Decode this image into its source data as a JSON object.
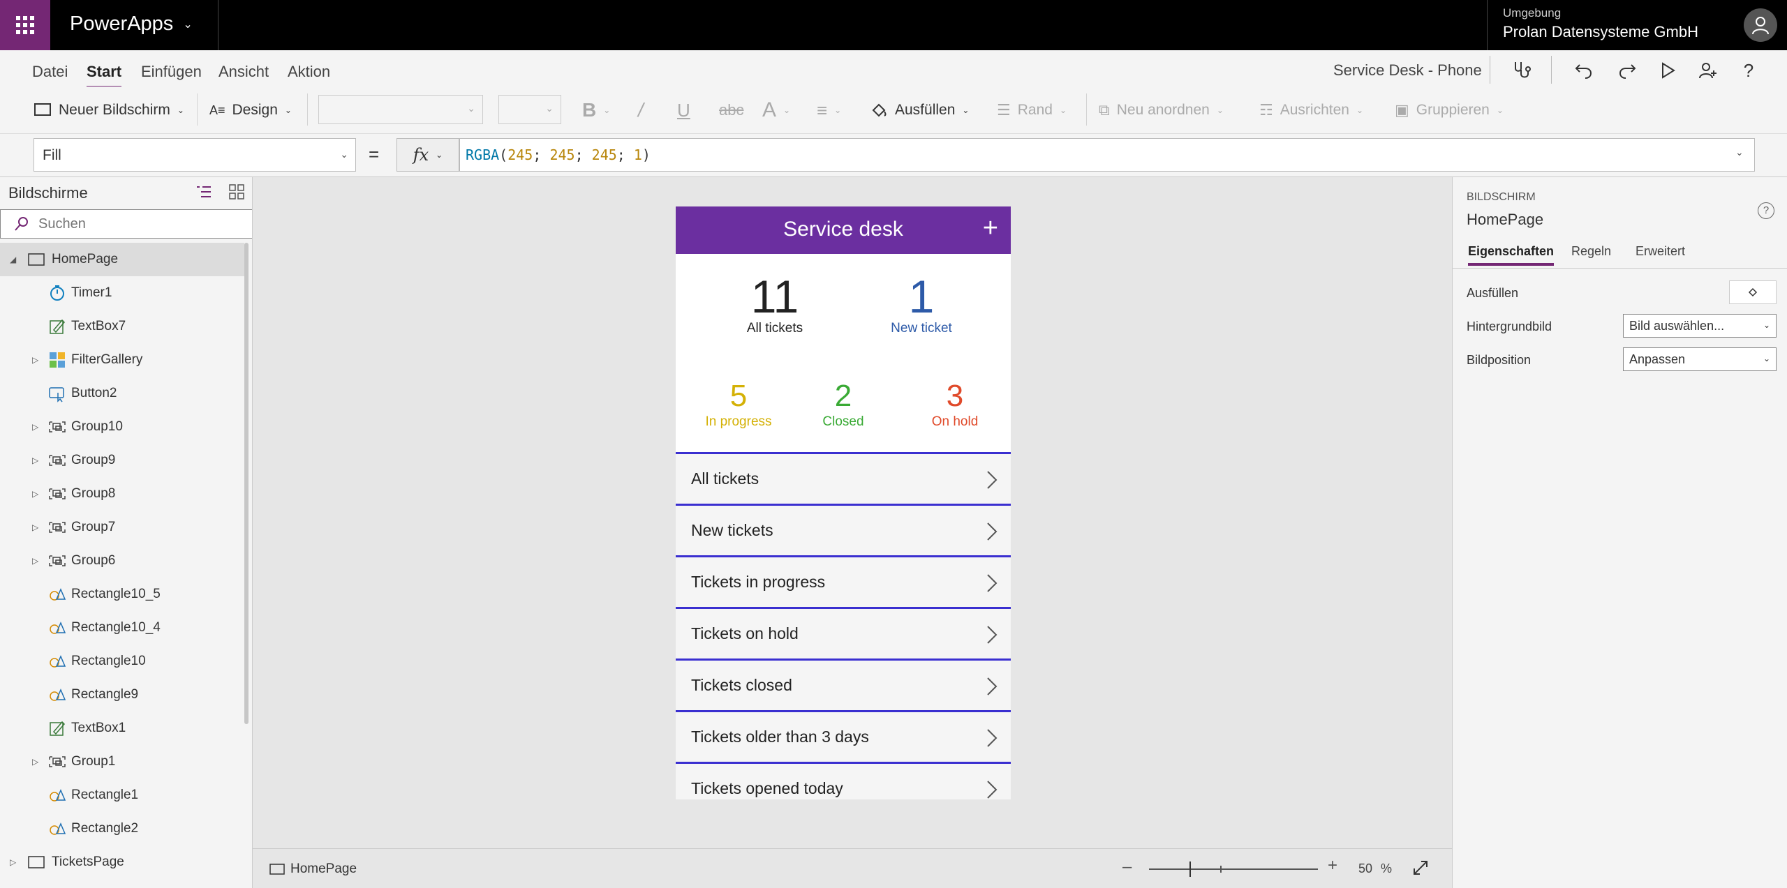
{
  "topbar": {
    "app_name": "PowerApps",
    "environment_label": "Umgebung",
    "environment_name": "Prolan Datensysteme GmbH"
  },
  "menu": {
    "items": [
      "Datei",
      "Start",
      "Einfügen",
      "Ansicht",
      "Aktion"
    ],
    "active": "Start",
    "document_title": "Service Desk - Phone"
  },
  "toolbar": {
    "new_screen": "Neuer Bildschirm",
    "design": "Design",
    "fill": "Ausfüllen",
    "border": "Rand",
    "reorder": "Neu anordnen",
    "align": "Ausrichten",
    "group": "Gruppieren"
  },
  "formula": {
    "property": "Fill",
    "equals": "=",
    "fx": "fx",
    "fn_name": "RGBA",
    "args": [
      "245",
      "245",
      "245",
      "1"
    ]
  },
  "left_panel": {
    "title": "Bildschirme",
    "search_placeholder": "Suchen",
    "tree": [
      {
        "label": "HomePage",
        "level": 0,
        "icon": "screen-icon",
        "expander": "open",
        "selected": true
      },
      {
        "label": "Timer1",
        "level": 1,
        "icon": "timer-icon",
        "expander": "none"
      },
      {
        "label": "TextBox7",
        "level": 1,
        "icon": "textbox-icon",
        "expander": "none"
      },
      {
        "label": "FilterGallery",
        "level": 1,
        "icon": "gallery-icon",
        "expander": "closed"
      },
      {
        "label": "Button2",
        "level": 1,
        "icon": "button-icon",
        "expander": "none"
      },
      {
        "label": "Group10",
        "level": 1,
        "icon": "group-icon",
        "expander": "closed"
      },
      {
        "label": "Group9",
        "level": 1,
        "icon": "group-icon",
        "expander": "closed"
      },
      {
        "label": "Group8",
        "level": 1,
        "icon": "group-icon",
        "expander": "closed"
      },
      {
        "label": "Group7",
        "level": 1,
        "icon": "group-icon",
        "expander": "closed"
      },
      {
        "label": "Group6",
        "level": 1,
        "icon": "group-icon",
        "expander": "closed"
      },
      {
        "label": "Rectangle10_5",
        "level": 1,
        "icon": "shape-icon",
        "expander": "none"
      },
      {
        "label": "Rectangle10_4",
        "level": 1,
        "icon": "shape-icon",
        "expander": "none"
      },
      {
        "label": "Rectangle10",
        "level": 1,
        "icon": "shape-icon",
        "expander": "none"
      },
      {
        "label": "Rectangle9",
        "level": 1,
        "icon": "shape-icon",
        "expander": "none"
      },
      {
        "label": "TextBox1",
        "level": 1,
        "icon": "textbox-icon",
        "expander": "none"
      },
      {
        "label": "Group1",
        "level": 1,
        "icon": "group-icon",
        "expander": "closed"
      },
      {
        "label": "Rectangle1",
        "level": 1,
        "icon": "shape-icon",
        "expander": "none"
      },
      {
        "label": "Rectangle2",
        "level": 1,
        "icon": "shape-icon",
        "expander": "none"
      },
      {
        "label": "TicketsPage",
        "level": 0,
        "icon": "screen-icon",
        "expander": "closed"
      }
    ]
  },
  "phone": {
    "title": "Service desk",
    "plus": "+",
    "stats_top": [
      {
        "num": "11",
        "label": "All tickets",
        "color": "#222222"
      },
      {
        "num": "1",
        "label": "New ticket",
        "color": "#2d5aa8"
      }
    ],
    "stats_bottom": [
      {
        "num": "5",
        "label": "In progress",
        "color": "#d4b106"
      },
      {
        "num": "2",
        "label": "Closed",
        "color": "#3aaa35"
      },
      {
        "num": "3",
        "label": "On hold",
        "color": "#e04a2a"
      }
    ],
    "list": [
      "All tickets",
      "New tickets",
      "Tickets in progress",
      "Tickets on hold",
      "Tickets closed",
      "Tickets older than 3 days",
      "Tickets opened today"
    ]
  },
  "canvas_footer": {
    "screen_name": "HomePage",
    "zoom": "50",
    "zoom_unit": "%"
  },
  "right_panel": {
    "kind": "BILDSCHIRM",
    "name": "HomePage",
    "tabs": [
      "Eigenschaften",
      "Regeln",
      "Erweitert"
    ],
    "active_tab": "Eigenschaften",
    "rows": {
      "fill_label": "Ausfüllen",
      "bg_label": "Hintergrundbild",
      "bg_value": "Bild auswählen...",
      "pos_label": "Bildposition",
      "pos_value": "Anpassen"
    }
  },
  "colors": {
    "brand": "#742774",
    "phone_header": "#6b2fa0",
    "list_border": "#3a2fd0"
  }
}
